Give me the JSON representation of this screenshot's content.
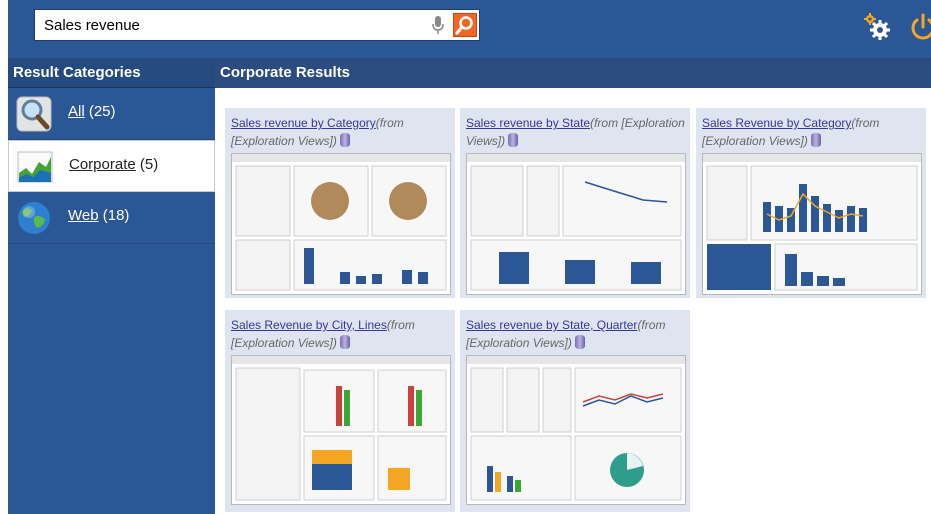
{
  "search": {
    "value": "Sales revenue"
  },
  "left": {
    "heading": "Result Categories",
    "categories": [
      {
        "name": "All",
        "count": "(25)"
      },
      {
        "name": "Corporate",
        "count": "(5)"
      },
      {
        "name": "Web",
        "count": "(18)"
      }
    ]
  },
  "main": {
    "heading": "Corporate Results",
    "results": [
      {
        "title": "Sales revenue by Category",
        "source": "(from [Exploration Views])"
      },
      {
        "title": "Sales revenue by State",
        "source": "(from [Exploration Views])"
      },
      {
        "title": "Sales Revenue by Category",
        "source": "(from [Exploration Views])"
      },
      {
        "title": "Sales Revenue by City, Lines",
        "source": "(from [Exploration Views])"
      },
      {
        "title": "Sales revenue by State, Quarter",
        "source": "(from [Exploration Views])"
      }
    ]
  },
  "colors": {
    "header": "#2b5797",
    "accent": "#f26522",
    "link": "#34389a",
    "selected_bg": "#ffffff"
  }
}
